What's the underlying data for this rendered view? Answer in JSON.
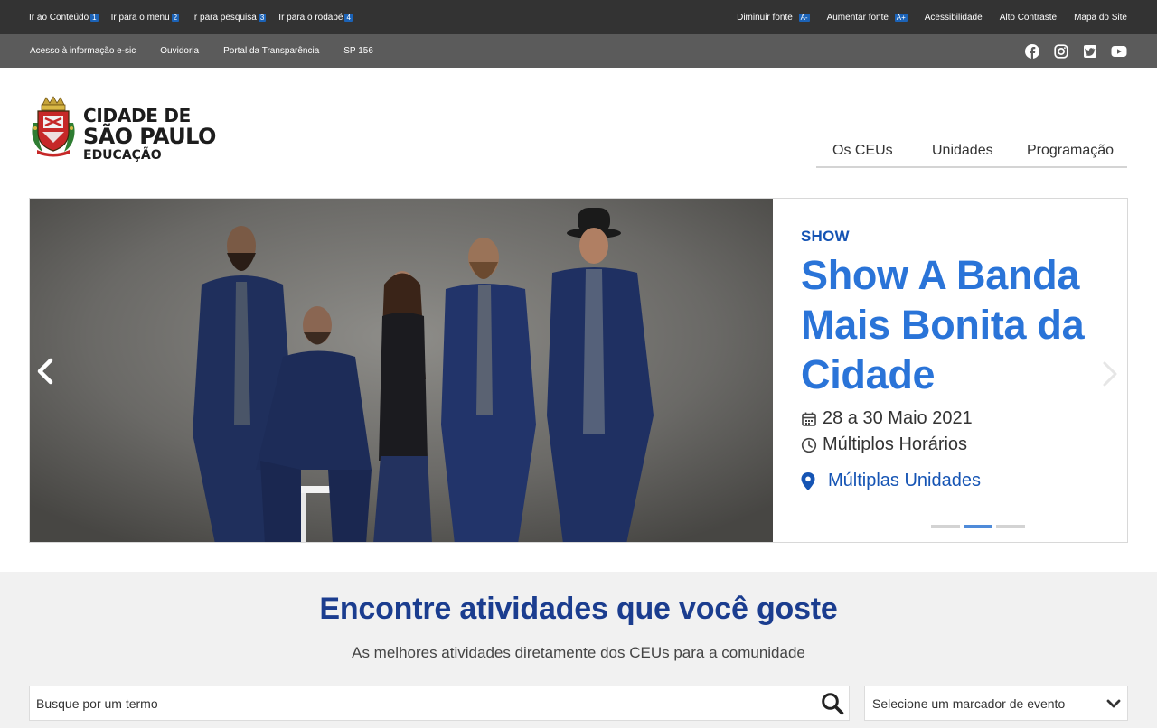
{
  "topbar": {
    "skip_links": [
      {
        "label": "Ir ao Conteúdo",
        "key": "1"
      },
      {
        "label": "Ir para o menu",
        "key": "2"
      },
      {
        "label": "Ir para pesquisa",
        "key": "3"
      },
      {
        "label": "Ir para o rodapé",
        "key": "4"
      }
    ],
    "font_decrease": {
      "label": "Diminuir fonte",
      "badge": "A-"
    },
    "font_increase": {
      "label": "Aumentar fonte",
      "badge": "A+"
    },
    "accessibility": "Acessibilidade",
    "high_contrast": "Alto Contraste",
    "sitemap": "Mapa do Site"
  },
  "secbar": {
    "links": [
      "Acesso à informação e-sic",
      "Ouvidoria",
      "Portal da Transparência",
      "SP 156"
    ],
    "social_icons": [
      "facebook-icon",
      "instagram-icon",
      "twitter-icon",
      "youtube-icon"
    ]
  },
  "logo": {
    "line1": "CIDADE DE",
    "line2": "SÃO PAULO",
    "line3": "EDUCAÇÃO"
  },
  "nav": {
    "items": [
      "Os CEUs",
      "Unidades",
      "Programação"
    ]
  },
  "hero": {
    "category": "SHOW",
    "title": "Show A Banda Mais Bonita da Cidade",
    "date": "28 a 30 Maio 2021",
    "time": "Múltiplos Horários",
    "location": "Múltiplas Unidades",
    "active_slide": 2,
    "slide_count": 3,
    "icons": {
      "date": "calendar-icon",
      "time": "clock-icon",
      "location": "map-pin-icon"
    }
  },
  "search": {
    "title": "Encontre atividades que você goste",
    "subtitle": "As melhores atividades diretamente dos CEUs para a comunidade",
    "placeholder": "Busque por um termo",
    "select_label": "Selecione um marcador de evento"
  },
  "colors": {
    "topbar": "#333333",
    "secbar": "#5b5b5b",
    "accent_blue": "#2a74d8",
    "dark_blue": "#1b3d8f",
    "link_blue": "#1554b4"
  }
}
